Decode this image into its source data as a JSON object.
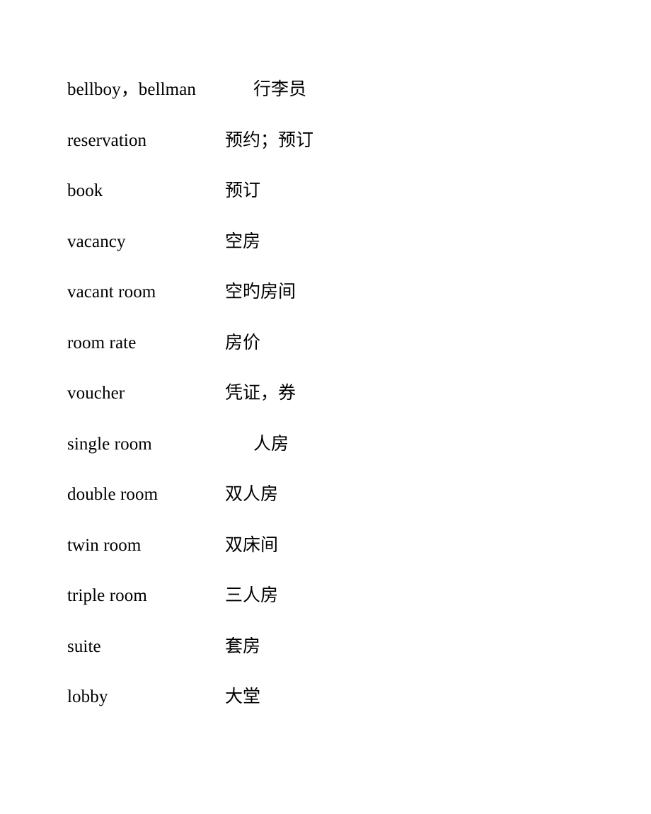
{
  "document": {
    "type": "vocabulary-glossary",
    "title": "",
    "entries": [
      {
        "term": "bellboy，bellman",
        "translation": "行李员",
        "indented": true
      },
      {
        "term": "reservation",
        "translation": "预约；预订",
        "indented": false
      },
      {
        "term": "book",
        "translation": "预订",
        "indented": false
      },
      {
        "term": "vacancy",
        "translation": "空房",
        "indented": false
      },
      {
        "term": "vacant room",
        "translation": "空旳房间",
        "indented": false
      },
      {
        "term": "room rate",
        "translation": "房价",
        "indented": false
      },
      {
        "term": "voucher",
        "translation": "凭证，券",
        "indented": false
      },
      {
        "term": "single room",
        "translation": "人房",
        "indented": true
      },
      {
        "term": "double room",
        "translation": "双人房",
        "indented": false
      },
      {
        "term": "twin room",
        "translation": "双床间",
        "indented": false
      },
      {
        "term": "triple room",
        "translation": "三人房",
        "indented": false
      },
      {
        "term": "suite",
        "translation": "套房",
        "indented": false
      },
      {
        "term": "lobby",
        "translation": "大堂",
        "indented": false
      }
    ]
  }
}
